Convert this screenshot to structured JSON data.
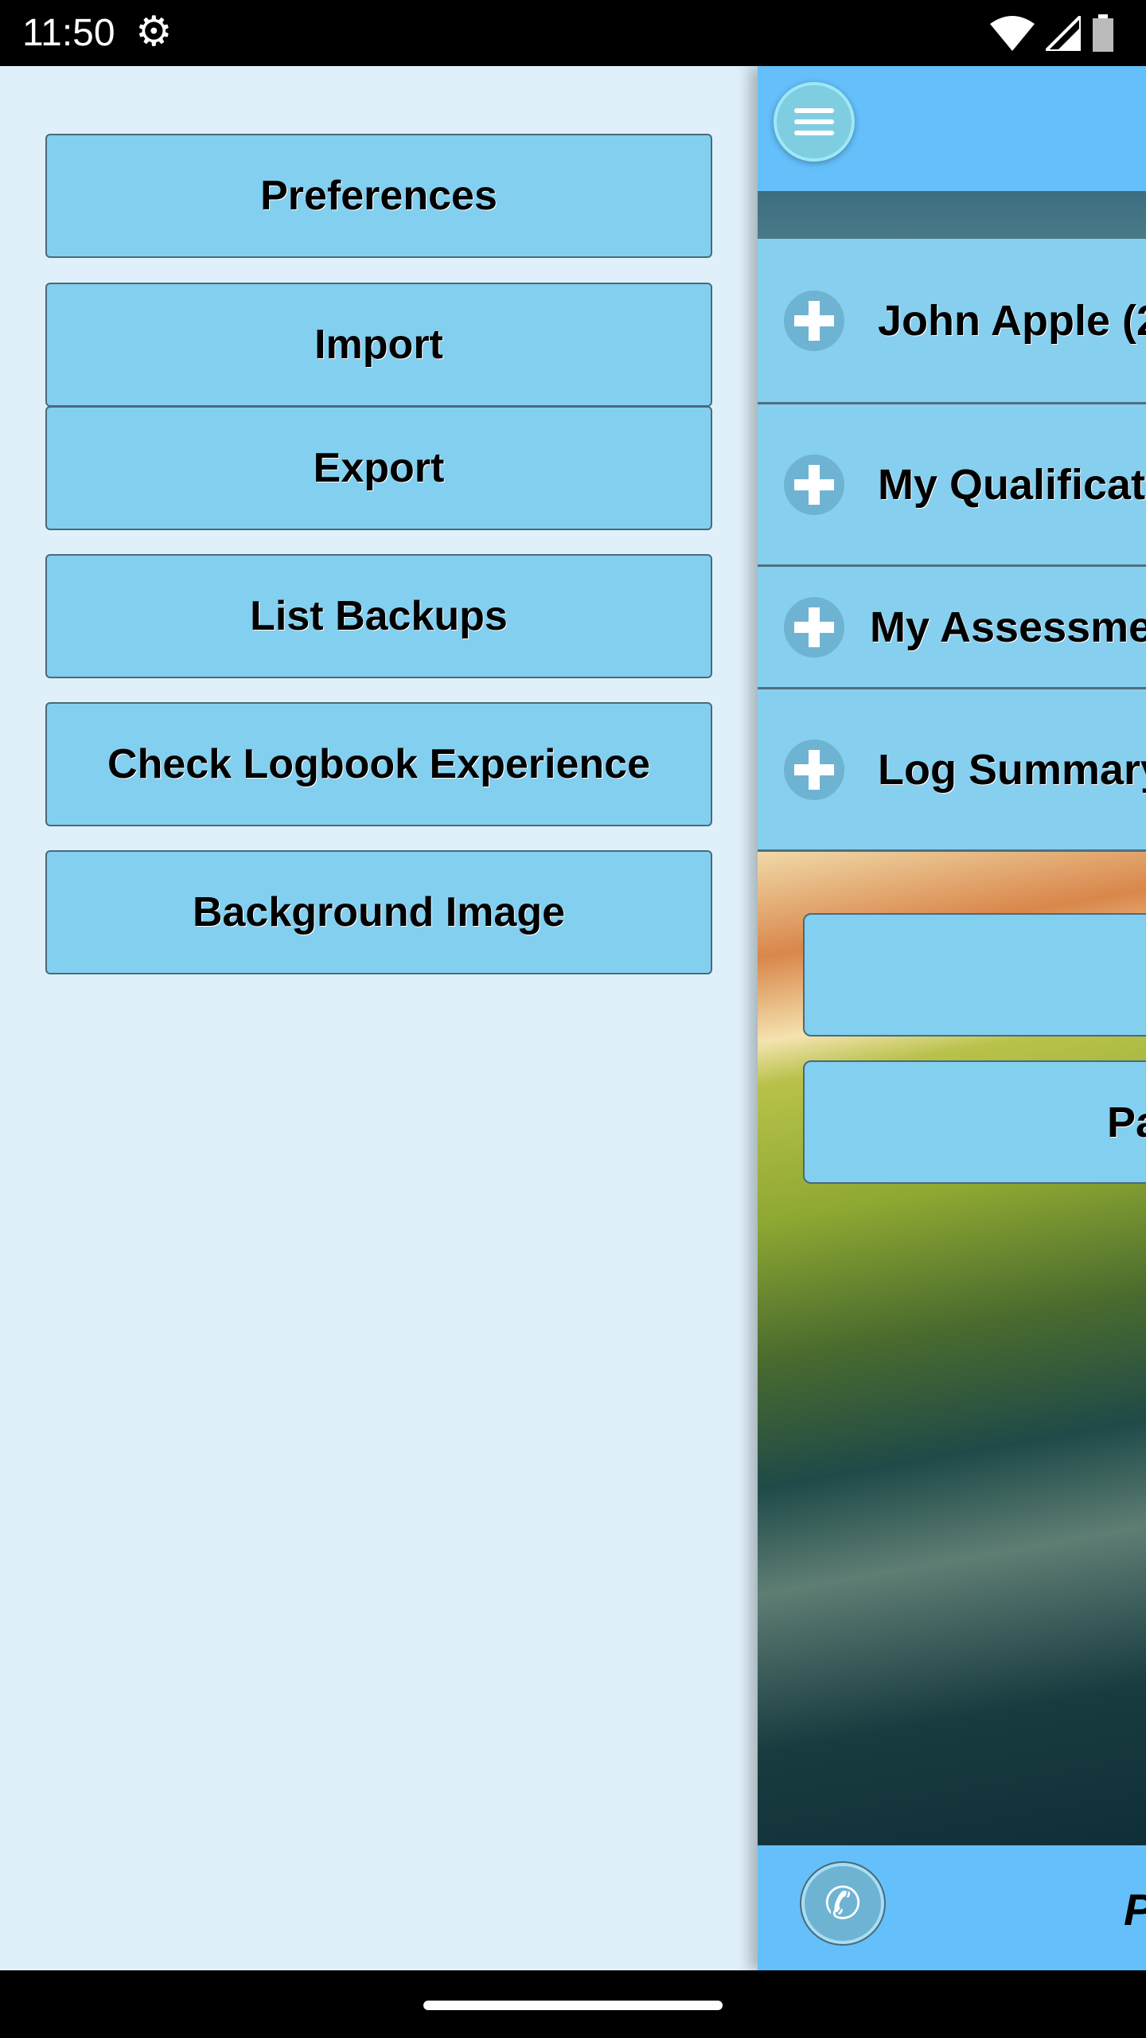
{
  "status_bar": {
    "time": "11:50",
    "icons": [
      "gear-icon",
      "wifi-icon",
      "signal-icon",
      "battery-icon"
    ]
  },
  "drawer": {
    "items": [
      {
        "label": "Preferences"
      },
      {
        "label": "Import"
      },
      {
        "label": "Export"
      },
      {
        "label": "List Backups"
      },
      {
        "label": "Check Logbook Experience"
      },
      {
        "label": "Background Image"
      }
    ]
  },
  "main": {
    "menu_icon": "hamburger-menu-icon",
    "rows": [
      {
        "label": "John Apple (2"
      },
      {
        "label": "My Qualificati"
      },
      {
        "label": "My Assessme"
      },
      {
        "label": "Log Summary"
      }
    ],
    "buttons": [
      {
        "label": ""
      },
      {
        "label": "Pa"
      }
    ],
    "footer": {
      "phone_icon": "phone-icon",
      "text": "P"
    }
  },
  "colors": {
    "drawer_bg": "#dff0fa",
    "button_bg": "#83cfef",
    "header_bg": "#64bffa"
  }
}
